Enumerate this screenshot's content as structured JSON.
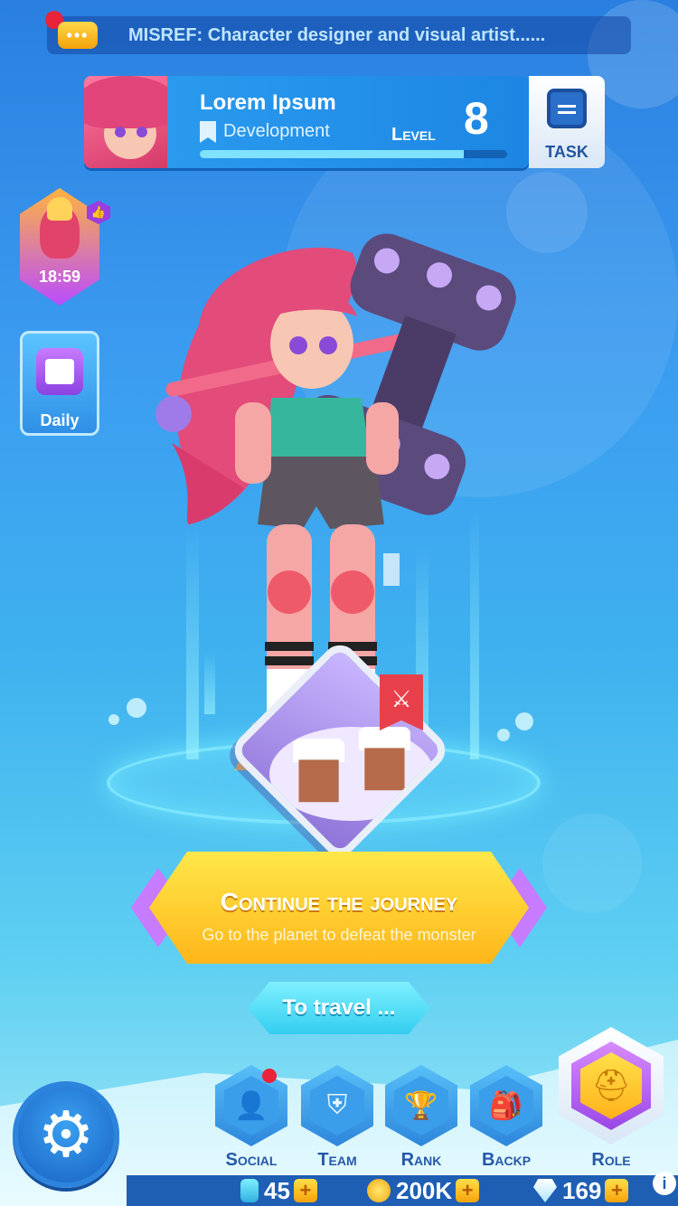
{
  "message_bar": {
    "icon": "chat-bubble-icon",
    "text": "MISREF: Character designer and visual artist......"
  },
  "profile": {
    "name": "Lorem Ipsum",
    "role": "Development",
    "level_label": "Level",
    "level": "8",
    "xp_progress": 0.86
  },
  "task": {
    "label": "TASK",
    "icon": "task-calendar-icon"
  },
  "event": {
    "timer": "18:59",
    "badge_icon": "thumbs-up-icon"
  },
  "daily": {
    "label": "Daily",
    "icon": "calendar-icon"
  },
  "stage": {
    "badge_icon": "crossed-swords-icon"
  },
  "continue": {
    "title": "Continue the journey",
    "subtitle": "Go to the planet to defeat the monster"
  },
  "travel": {
    "label": "To travel ..."
  },
  "settings": {
    "icon": "gear-icon"
  },
  "nav": {
    "items": [
      {
        "label": "Social",
        "icon": "social-icon"
      },
      {
        "label": "Team",
        "icon": "team-shield-icon"
      },
      {
        "label": "Rank",
        "icon": "trophy-icon"
      },
      {
        "label": "Backp",
        "icon": "backpack-icon"
      }
    ],
    "role": {
      "label": "Role",
      "icon": "helmet-icon"
    }
  },
  "currency": {
    "energy": "45",
    "coins": "200K",
    "gems": "169"
  },
  "colors": {
    "accent_yellow": "#ffc72a",
    "accent_purple": "#b05ef0",
    "primary_blue": "#2c84dc"
  }
}
